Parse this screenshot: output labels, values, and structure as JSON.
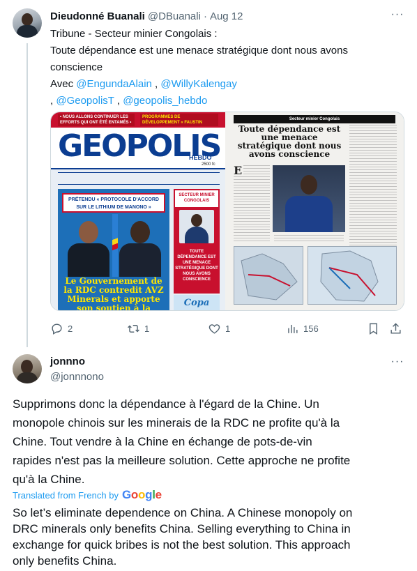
{
  "tweet1": {
    "name": "Dieudonné Buanali",
    "handle": "@DBuanali",
    "separator": "·",
    "date": "Aug 12",
    "more": "···",
    "text_lines": [
      "Tribune - Secteur minier Congolais :",
      "Toute dépendance est une menace stratégique dont nous avons",
      "conscience"
    ],
    "mentions_prefix": "Avec ",
    "mention1": "@EngundaAlain",
    "mention_sep1": " , ",
    "mention2": "@WillyKalengay",
    "mention_sep2": ", ",
    "mention3": "@GeopolisT",
    "mention_sep3": " , ",
    "mention4": "@geopolis_hebdo",
    "media": {
      "cover": {
        "strip_left": "• NOUS ALLONS CONTINUER LES EFFORTS QUI ONT ÉTÉ ENTAMÉS •",
        "strip_right": "PROGRAMMES DE DÉVELOPPEMENT « FAUSTIN LUANGA »",
        "masthead": "GEOPOLIS",
        "hebdo": "HEBDO",
        "price": "2500 fc",
        "headline": "PRÉTENDU « PROTOCOLE D'ACCORD SUR LE LITHIUM DE MANONO »",
        "big_headline": "Le Gouvernement de la RDC contredit AVZ Minerals et apporte son soutien à la COMINIERE",
        "side_title": "SECTEUR MINIER CONGOLAIS",
        "side_text": "TOUTE DÉPENDANCE EST UNE MENACE STRATÉGIQUE DONT NOUS AVONS CONSCIENCE",
        "side_foot": "Copa"
      },
      "article": {
        "rubric": "Secteur minier Congolais",
        "title": "Toute dépendance est une menace stratégique dont nous avons conscience",
        "dropcap": "E"
      }
    },
    "actions": {
      "replies": "2",
      "retweets": "1",
      "likes": "1",
      "views": "156"
    }
  },
  "tweet2": {
    "name": "jonnno",
    "handle": "@jonnnono",
    "more": "···",
    "body_lines": [
      "Supprimons donc la dépendance à l'égard de la Chine. Un",
      "monopole chinois sur les minerais de la RDC ne profite qu'à la",
      "Chine. Tout vendre à la Chine en échange de pots-de-vin",
      "rapides n'est pas la meilleure solution. Cette approche ne profite",
      "qu'à la Chine."
    ],
    "translated_label": "Translated from French by",
    "google_letters": [
      "G",
      "o",
      "o",
      "g",
      "l",
      "e"
    ],
    "translation_lines": [
      "So let’s eliminate dependence on China. A Chinese monopoly on",
      "DRC minerals only benefits China. Selling everything to China in",
      "exchange for quick bribes is not the best solution. This approach",
      "only benefits China."
    ]
  },
  "colors": {
    "link": "#1d9bf0",
    "secondary_text": "#536471",
    "primary_text": "#0f1419",
    "thread_line": "#cfd9de"
  },
  "icons": {
    "reply": "reply-icon",
    "retweet": "retweet-icon",
    "like": "heart-icon",
    "views": "views-icon",
    "bookmark": "bookmark-icon",
    "share": "share-icon"
  }
}
